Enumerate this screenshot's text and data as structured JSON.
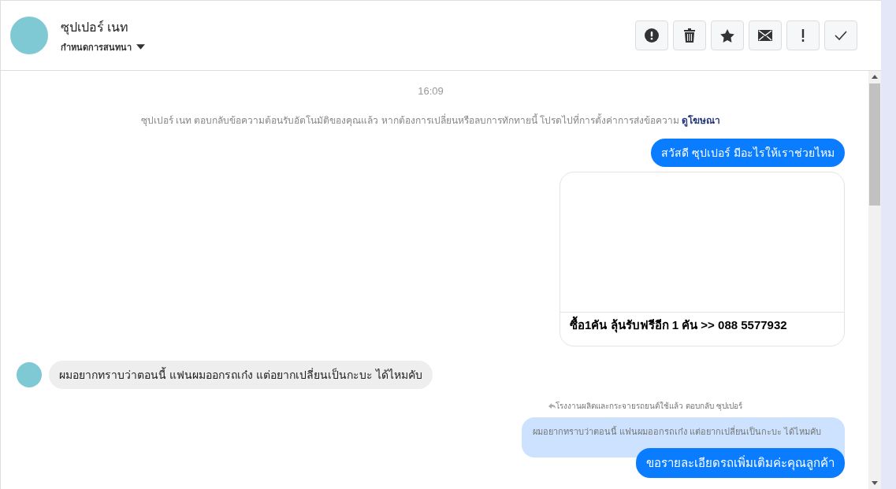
{
  "header": {
    "name": "ซุปเปอร์ เนท",
    "assign_label": "กำหนดการสนทนา"
  },
  "toolbar_buttons": [
    {
      "kind": "alert"
    },
    {
      "kind": "trash"
    },
    {
      "kind": "star"
    },
    {
      "kind": "mail"
    },
    {
      "kind": "exclaim"
    },
    {
      "kind": "check"
    }
  ],
  "messages": [
    {
      "kind": "timestamp",
      "text": "16:09"
    },
    {
      "kind": "notice",
      "text": "ซุปเปอร์ เนท ตอบกลับข้อความต้อนรับอัตโนมัติของคุณแล้ว หากต้องการเปลี่ยนหรือลบการทักทายนี้ โปรดไปที่การตั้งค่าการส่งข้อความ",
      "link": "ดูโฆษณา"
    },
    {
      "kind": "outgoing",
      "text": "สวัสดี ซุปเปอร์ มีอะไรให้เราช่วยไหม"
    },
    {
      "kind": "card",
      "caption": "ซื้อ1คัน ลุ้นรับฟรีอีก 1 คัน >> 088 5577932"
    },
    {
      "kind": "incoming",
      "text": "ผมอยากทราบว่าตอนนี้ แฟนผมออกรถเก๋ง แต่อยากเปลี่ยนเป็นกะบะ ได้ไหมคับ"
    },
    {
      "kind": "reply",
      "label": "โรงงานผลิตและกระจายรถยนต์ใช้แล้ว ตอบกลับ ซุปเปอร์",
      "quote": "ผมอยากทราบว่าตอนนี้ แฟนผมออกรถเก๋ง แต่อยากเปลี่ยนเป็นกะบะ ได้ไหมคับ",
      "text": "ขอรายละเอียดรถเพิ่มเติมค่ะคุณลูกค้า"
    }
  ]
}
